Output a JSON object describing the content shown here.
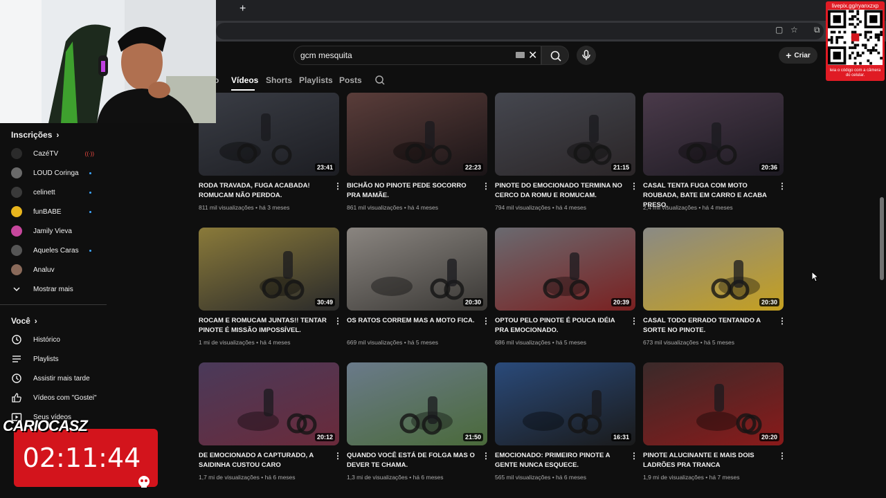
{
  "browser": {
    "new_tab": "+",
    "tab_close": "×"
  },
  "search": {
    "query": "gcm mesquita"
  },
  "header": {
    "create_label": "Criar"
  },
  "tabs": [
    "o",
    "Vídeos",
    "Shorts",
    "Playlists",
    "Posts"
  ],
  "sidebar": {
    "subscriptions_title": "Inscrições",
    "subscriptions": [
      {
        "name": "CazéTV",
        "color": "#2b2b2b",
        "badge": "live"
      },
      {
        "name": "LOUD Coringa",
        "color": "#6a6a6a",
        "badge": "dot"
      },
      {
        "name": "celinett",
        "color": "#3a3a3a",
        "badge": "dot"
      },
      {
        "name": "funBABE",
        "color": "#e8b51d",
        "badge": "dot"
      },
      {
        "name": "Jamily Vieva",
        "color": "#c7479d",
        "badge": ""
      },
      {
        "name": "Aqueles Caras",
        "color": "#555",
        "badge": "dot"
      },
      {
        "name": "Analuv",
        "color": "#8a6a5a",
        "badge": ""
      }
    ],
    "show_more": "Mostrar mais",
    "you_title": "Você",
    "you_items": [
      {
        "label": "Histórico",
        "icon": "history-icon"
      },
      {
        "label": "Playlists",
        "icon": "playlists-icon"
      },
      {
        "label": "Assistir mais tarde",
        "icon": "watch-later-icon"
      },
      {
        "label": "Vídeos com \"Gostei\"",
        "icon": "like-icon"
      },
      {
        "label": "Seus vídeos",
        "icon": "your-videos-icon"
      }
    ]
  },
  "videos": [
    {
      "title": "RODA TRAVADA, FUGA ACABADA! ROMUCAM NÃO PERDOA.",
      "views": "811 mil visualizações",
      "age": "há 3 meses",
      "duration": "23:41",
      "colors": [
        "#3a3d45",
        "#1c1d22"
      ]
    },
    {
      "title": "BICHÃO NO PINOTE PEDE SOCORRO PRA MAMÃE.",
      "views": "861 mil visualizações",
      "age": "há 4 meses",
      "duration": "22:23",
      "colors": [
        "#5a3d3a",
        "#1a1416"
      ]
    },
    {
      "title": "PINOTE DO EMOCIONADO TERMINA NO CERCO DA ROMU E ROMUCAM.",
      "views": "794 mil visualizações",
      "age": "há 4 meses",
      "duration": "21:15",
      "colors": [
        "#45474f",
        "#2a2527"
      ]
    },
    {
      "title": "CASAL TENTA FUGA COM MOTO ROUBADA, BATE EM CARRO E ACABA PRESO.",
      "views": "2,4 mil visualizações",
      "age": "há 4 meses",
      "duration": "20:36",
      "colors": [
        "#4a3a4a",
        "#1d1a22"
      ]
    },
    {
      "title": "ROCAM E ROMUCAM JUNTAS!! TENTAR PINOTE É MISSÃO IMPOSSÍVEL.",
      "views": "1 mi de visualizações",
      "age": "há 4 meses",
      "duration": "30:49",
      "colors": [
        "#8a7a3a",
        "#2a2a2a"
      ]
    },
    {
      "title": "OS RATOS CORREM MAS A MOTO FICA.",
      "views": "669 mil visualizações",
      "age": "há 5 meses",
      "duration": "20:30",
      "colors": [
        "#8a8580",
        "#3a3835"
      ]
    },
    {
      "title": "OPTOU PELO PINOTE É POUCA IDÉIA PRA EMOCIONADO.",
      "views": "686 mil visualizações",
      "age": "há 5 meses",
      "duration": "20:39",
      "colors": [
        "#6a6a70",
        "#7a2020"
      ]
    },
    {
      "title": "CASAL TODO ERRADO TENTANDO A SORTE NO PINOTE.",
      "views": "673 mil visualizações",
      "age": "há 5 meses",
      "duration": "20:30",
      "colors": [
        "#8a8a85",
        "#c5a020"
      ]
    },
    {
      "title": "DE EMOCIONADO A CAPTURADO, A SAIDINHA CUSTOU CARO",
      "views": "1,7 mi de visualizações",
      "age": "há 6 meses",
      "duration": "20:12",
      "colors": [
        "#4a3a5a",
        "#6a2a3a"
      ]
    },
    {
      "title": "QUANDO VOCÊ ESTÁ DE FOLGA MAS O DEVER TE CHAMA.",
      "views": "1,3 mi de visualizações",
      "age": "há 6 meses",
      "duration": "21:50",
      "colors": [
        "#6a7a8a",
        "#4a6a3a"
      ]
    },
    {
      "title": "EMOCIONADO: PRIMEIRO PINOTE A GENTE NUNCA ESQUECE.",
      "views": "565 mil visualizações",
      "age": "há 6 meses",
      "duration": "16:31",
      "colors": [
        "#2a4a7a",
        "#1a1a1a"
      ]
    },
    {
      "title": "PINOTE ALUCINANTE E MAIS DOIS LADRÕES PRA TRANCA",
      "views": "1,9 mi de visualizações",
      "age": "há 7 meses",
      "duration": "20:20",
      "colors": [
        "#3a2a2a",
        "#8a1a1a"
      ]
    }
  ],
  "overlay": {
    "qr_handle": "livepix.gg/ryanxzxp",
    "qr_caption": "leia o código com a câmera do celular.",
    "timer": "02:11:44",
    "streamer_tag": "CARIOCASZ"
  }
}
